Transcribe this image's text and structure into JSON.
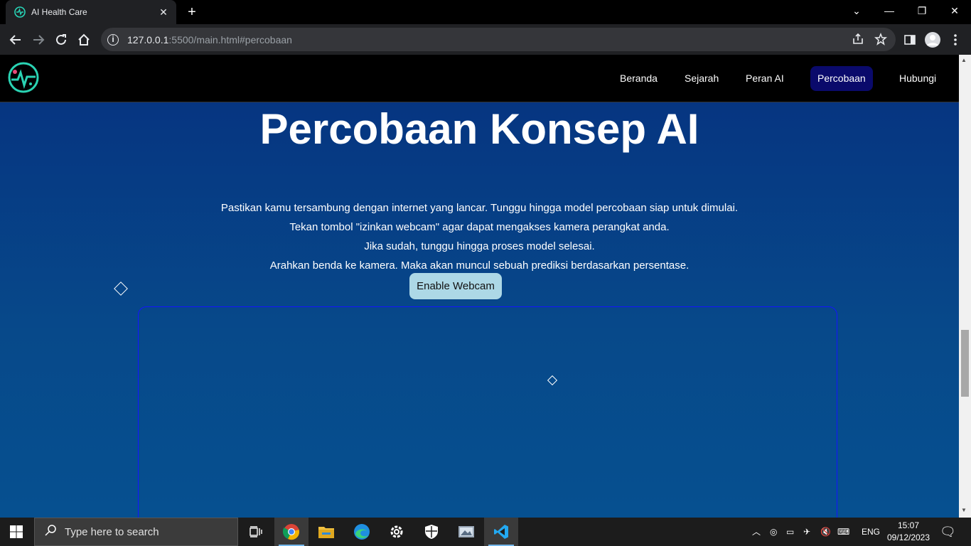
{
  "browser": {
    "tab_title": "AI Health Care",
    "tab_close": "✕",
    "new_tab": "+",
    "url_host": "127.0.0.1",
    "url_rest": ":5500/main.html#percobaan",
    "window_controls": [
      "⌄",
      "—",
      "❐",
      "✕"
    ]
  },
  "nav": {
    "items": [
      {
        "label": "Beranda",
        "active": false
      },
      {
        "label": "Sejarah",
        "active": false
      },
      {
        "label": "Peran AI",
        "active": false
      },
      {
        "label": "Percobaan",
        "active": true
      },
      {
        "label": "Hubungi",
        "active": false
      }
    ]
  },
  "main": {
    "heading": "Percobaan Konsep AI",
    "instructions": [
      "Pastikan kamu tersambung dengan internet yang lancar. Tunggu hingga model percobaan siap untuk dimulai.",
      "Tekan tombol \"izinkan webcam\" agar dapat mengakses kamera perangkat anda.",
      "Jika sudah, tunggu hingga proses model selesai.",
      "Arahkan benda ke kamera. Maka akan muncul sebuah prediksi berdasarkan persentase."
    ],
    "webcam_button": "Enable Webcam"
  },
  "taskbar": {
    "search_placeholder": "Type here to search",
    "language": "ENG",
    "time": "15:07",
    "date": "09/12/2023",
    "apps": [
      "task-view-icon",
      "chrome-icon",
      "file-explorer-icon",
      "edge-icon",
      "settings-icon",
      "security-icon",
      "photos-icon",
      "vscode-icon"
    ]
  },
  "colors": {
    "page_gradient_top": "#06317f",
    "page_gradient_bottom": "#065090",
    "nav_active": "#0a0a6b",
    "button_bg": "#add8e6"
  }
}
